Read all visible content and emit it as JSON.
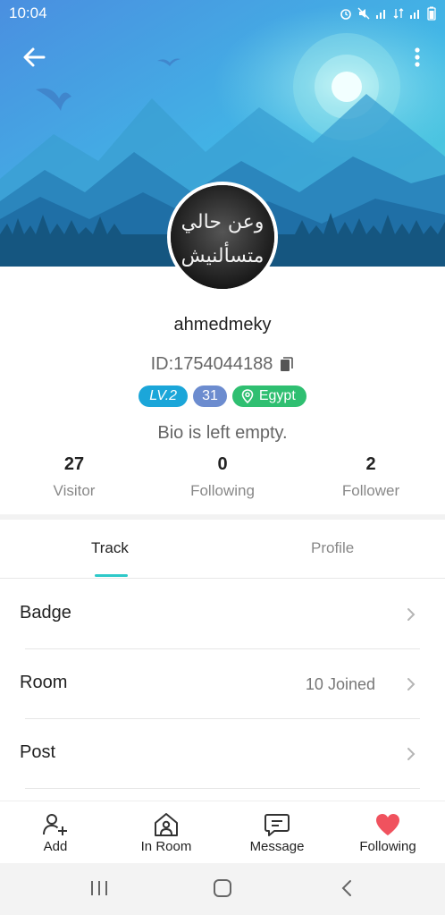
{
  "status_bar": {
    "time": "10:04",
    "icons": [
      "alarm-icon",
      "mute-icon",
      "signal-icon",
      "data-icon",
      "signal-icon-2",
      "battery-icon"
    ]
  },
  "header": {
    "back_icon": "arrow-left-icon",
    "more_icon": "more-vertical-icon"
  },
  "profile": {
    "username": "ahmedmeky",
    "id_text": "ID:1754044188",
    "level": "LV.2",
    "age": "31",
    "location": "Egypt",
    "bio": "Bio is left empty.",
    "avatar_text_line1": "وعن حالي",
    "avatar_text_line2": "متسألنيش"
  },
  "stats": [
    {
      "value": "27",
      "label": "Visitor"
    },
    {
      "value": "0",
      "label": "Following"
    },
    {
      "value": "2",
      "label": "Follower"
    }
  ],
  "tabs": [
    {
      "label": "Track",
      "active": true
    },
    {
      "label": "Profile",
      "active": false
    }
  ],
  "menu": [
    {
      "label": "Badge",
      "value": ""
    },
    {
      "label": "Room",
      "value": "10 Joined"
    },
    {
      "label": "Post",
      "value": ""
    }
  ],
  "bottom_nav": [
    {
      "label": "Add",
      "icon": "add-user-icon"
    },
    {
      "label": "In Room",
      "icon": "house-user-icon"
    },
    {
      "label": "Message",
      "icon": "message-icon"
    },
    {
      "label": "Following",
      "icon": "heart-icon"
    }
  ],
  "colors": {
    "accent": "#2ec9c9",
    "level_badge": "#1ba6d9",
    "age_badge": "#6c8ccf",
    "location_badge": "#2fbf71",
    "heart": "#f0525e"
  }
}
